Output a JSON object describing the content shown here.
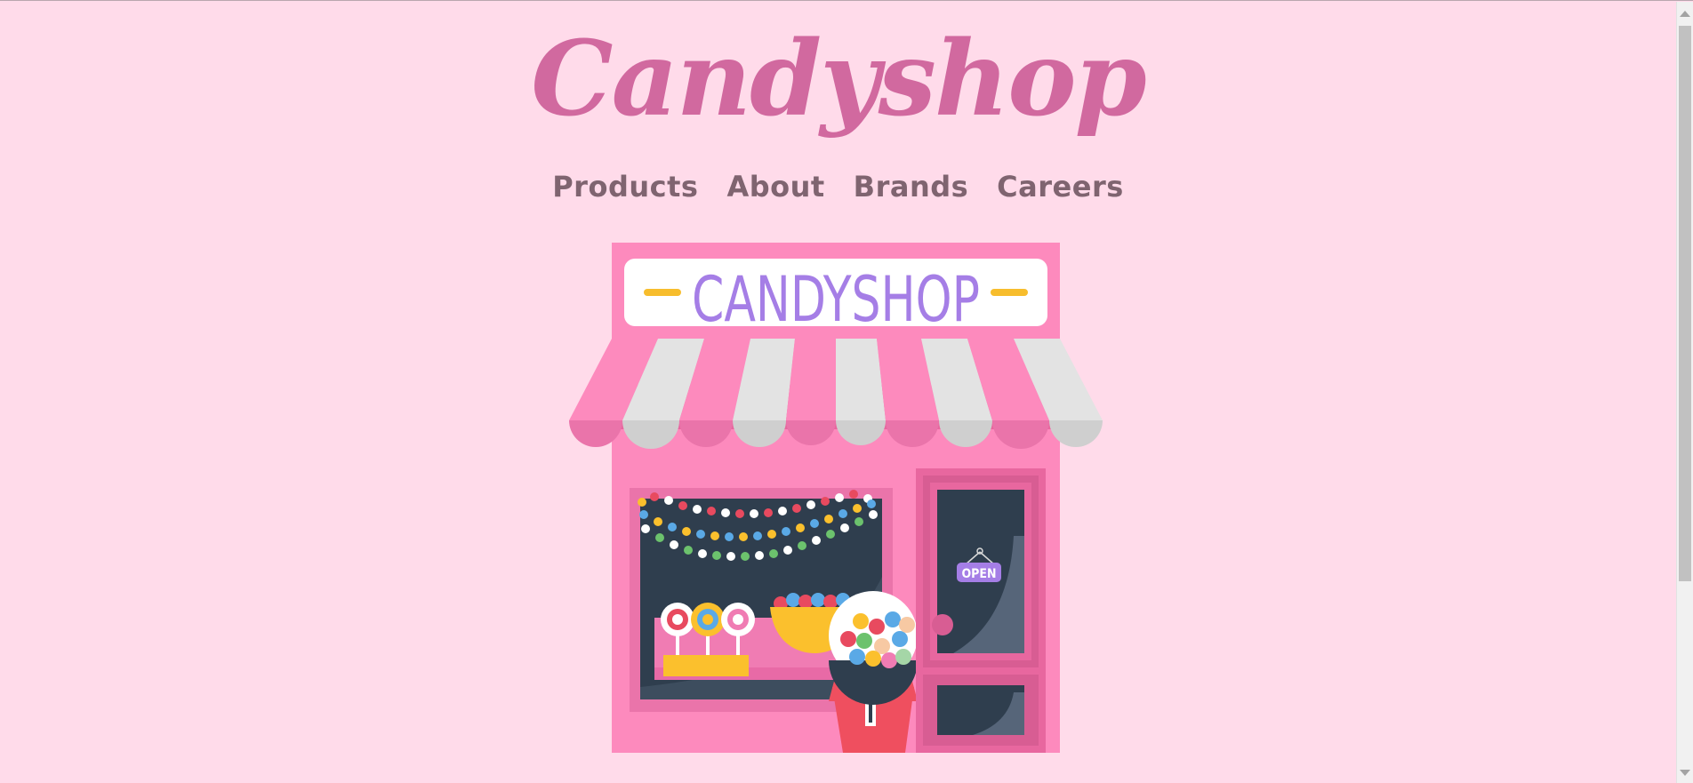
{
  "header": {
    "logo": "Candyshop"
  },
  "nav": {
    "items": [
      "Products",
      "About",
      "Brands",
      "Careers"
    ]
  },
  "hero": {
    "sign_text": "CANDYSHOP",
    "door_sign": "OPEN"
  },
  "colors": {
    "background": "#ffdbea",
    "logo": "#d1699f",
    "nav_text": "#7f6470",
    "shop_pink": "#fd8abd",
    "sign_text": "#a57ee6"
  }
}
